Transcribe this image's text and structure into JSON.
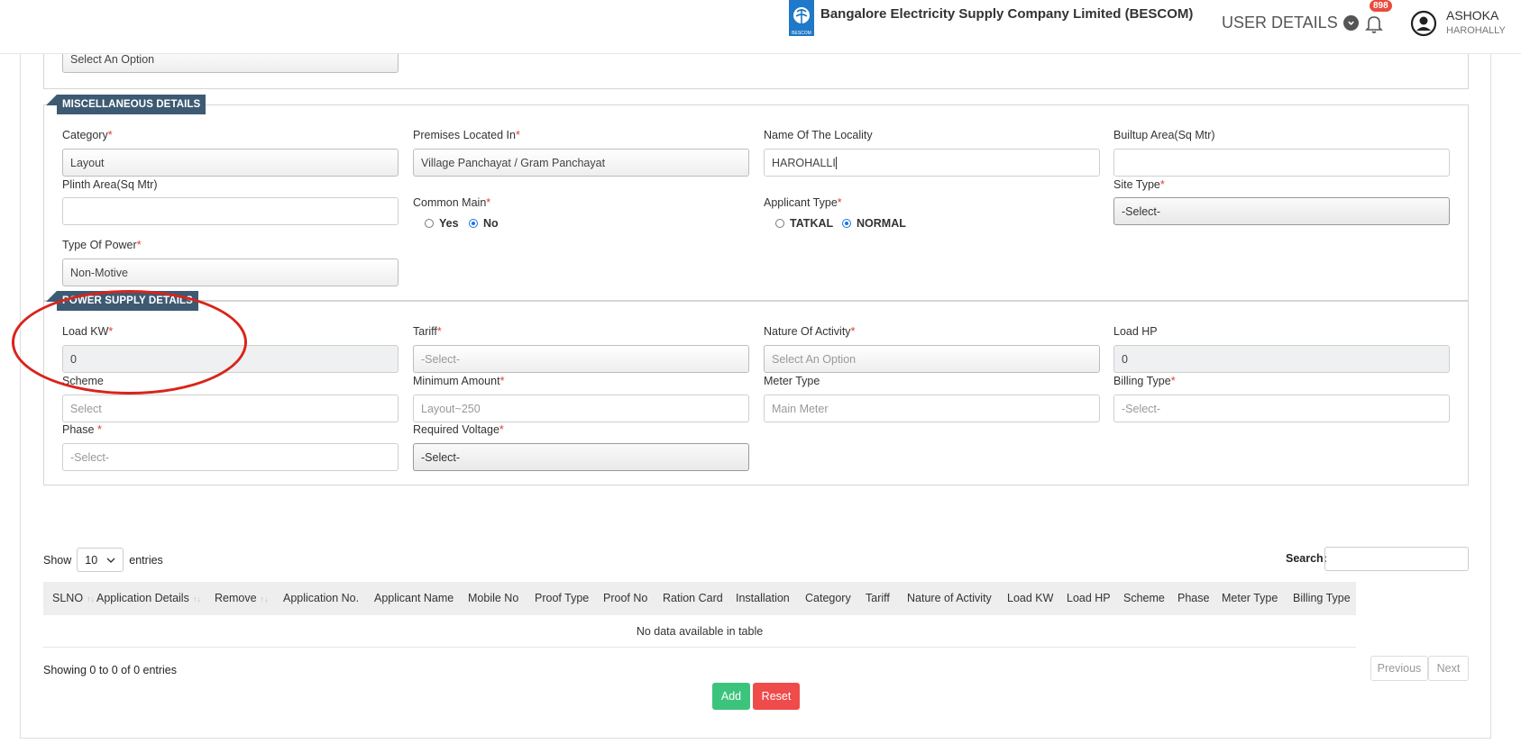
{
  "header": {
    "brand": "Bangalore Electricity Supply Company Limited (BESCOM)",
    "logo_text": "BESCOM",
    "user_details_label": "USER DETAILS",
    "notification_count": "898",
    "user_name": "ASHOKA",
    "user_location": "HAROHALLY"
  },
  "top_section": {
    "select_value": "Select An Option"
  },
  "misc": {
    "title": "MISCELLANEOUS DETAILS",
    "category_label": "Category",
    "category_value": "Layout",
    "premises_label": "Premises Located In",
    "premises_value": "Village Panchayat / Gram Panchayat",
    "locality_label": "Name Of The Locality",
    "locality_value": "HAROHALLI",
    "builtup_label": "Builtup Area(Sq Mtr)",
    "builtup_value": "",
    "plinth_label": "Plinth Area(Sq Mtr)",
    "plinth_value": "",
    "common_main_label": "Common Main",
    "common_main_yes": "Yes",
    "common_main_no": "No",
    "applicant_type_label": "Applicant Type",
    "applicant_tatkal": "TATKAL",
    "applicant_normal": "NORMAL",
    "site_type_label": "Site Type",
    "site_type_value": "-Select-",
    "power_type_label": "Type Of Power",
    "power_type_value": "Non-Motive"
  },
  "power": {
    "title": "POWER SUPPLY DETAILS",
    "load_kw_label": "Load KW",
    "load_kw_value": "0",
    "tariff_label": "Tariff",
    "tariff_value": "-Select-",
    "nature_label": "Nature Of Activity",
    "nature_value": "Select An Option",
    "load_hp_label": "Load HP",
    "load_hp_value": "0",
    "scheme_label": "Scheme",
    "scheme_value": "Select",
    "min_amount_label": "Minimum Amount",
    "min_amount_value": "Layout~250",
    "meter_type_label": "Meter Type",
    "meter_type_value": "Main Meter",
    "billing_type_label": "Billing Type",
    "billing_type_value": "-Select-",
    "phase_label": "Phase",
    "phase_value": "-Select-",
    "voltage_label": "Required Voltage",
    "voltage_value": "-Select-"
  },
  "table": {
    "show_label": "Show",
    "page_length": "10",
    "entries_label": "entries",
    "search_label": "Search:",
    "columns": [
      "SLNO",
      "Application Details",
      "Remove",
      "Application No.",
      "Applicant Name",
      "Mobile No",
      "Proof Type",
      "Proof No",
      "Ration Card",
      "Installation",
      "Category",
      "Tariff",
      "Nature of Activity",
      "Load KW",
      "Load HP",
      "Scheme",
      "Phase",
      "Meter Type",
      "Billing Type"
    ],
    "empty_message": "No data available in table",
    "info": "Showing 0 to 0 of 0 entries",
    "previous_label": "Previous",
    "next_label": "Next"
  },
  "actions": {
    "add_label": "Add",
    "reset_label": "Reset",
    "add_color": "#3cc47c",
    "reset_color": "#ef4b4b"
  }
}
